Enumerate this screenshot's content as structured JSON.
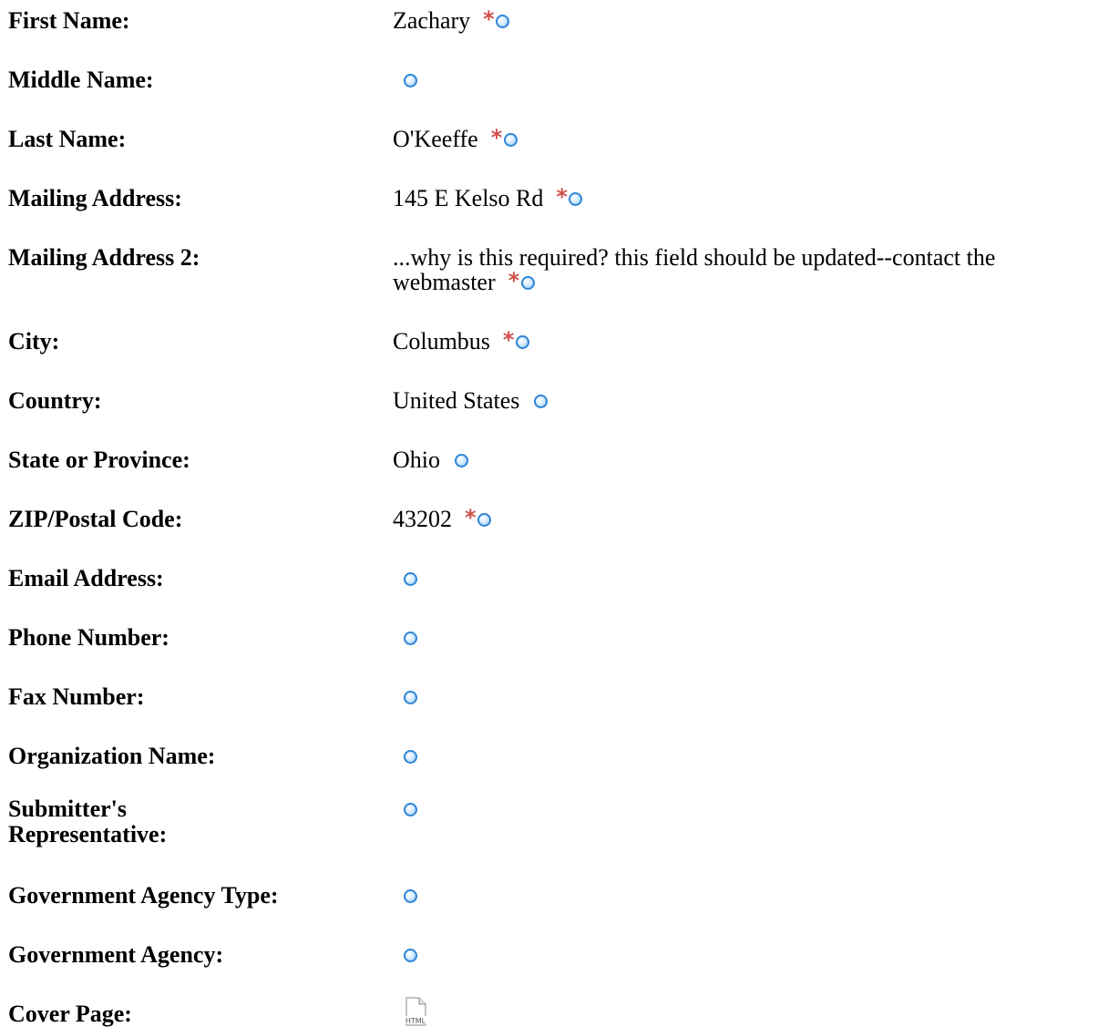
{
  "fields": [
    {
      "label": "First Name:",
      "value": "Zachary",
      "required": true,
      "globe": "globe-icon"
    },
    {
      "label": "Middle Name:",
      "value": "",
      "required": false,
      "globe": "globe-icon"
    },
    {
      "label": "Last Name:",
      "value": "O'Keeffe",
      "required": true,
      "globe": "globe-icon"
    },
    {
      "label": "Mailing Address:",
      "value": "145 E Kelso Rd",
      "required": true,
      "globe": "globe-icon"
    },
    {
      "label": "Mailing Address 2:",
      "value": "...why is this required? this field should be updated--contact the webmaster",
      "required": true,
      "globe": "globe-icon"
    },
    {
      "label": "City:",
      "value": "Columbus",
      "required": true,
      "globe": "globe-icon"
    },
    {
      "label": "Country:",
      "value": "United States",
      "required": false,
      "globe": "globe-icon"
    },
    {
      "label": "State or Province:",
      "value": "Ohio",
      "required": false,
      "globe": "globe-icon"
    },
    {
      "label": "ZIP/Postal Code:",
      "value": "43202",
      "required": true,
      "globe": "globe-icon"
    },
    {
      "label": "Email Address:",
      "value": "",
      "required": false,
      "globe": "globe-icon"
    },
    {
      "label": "Phone Number:",
      "value": "",
      "required": false,
      "globe": "globe-icon"
    },
    {
      "label": "Fax Number:",
      "value": "",
      "required": false,
      "globe": "globe-icon"
    },
    {
      "label": "Organization Name:",
      "value": "",
      "required": false,
      "globe": "globe-icon"
    },
    {
      "label": "Submitter's Representative:",
      "value": "",
      "required": false,
      "globe": "globe-icon"
    },
    {
      "label": "Government Agency Type:",
      "value": "",
      "required": false,
      "globe": "globe-icon"
    },
    {
      "label": "Government Agency:",
      "value": "",
      "required": false,
      "globe": "globe-icon"
    }
  ],
  "cover_page": {
    "label": "Cover Page:",
    "icon": "html-file-icon",
    "icon_text": "HTML"
  },
  "colors": {
    "required_marker": "#d0504c",
    "globe_icon": "#2f86d6"
  }
}
